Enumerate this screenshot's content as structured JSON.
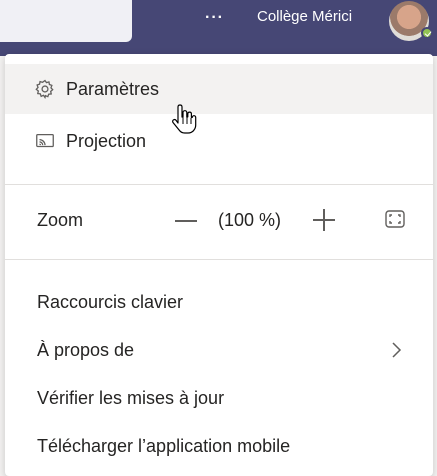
{
  "topbar": {
    "more_label": "···",
    "org_name": "Collège Mérici"
  },
  "menu": {
    "settings_label": "Paramètres",
    "cast_label": "Projection",
    "zoom_label": "Zoom",
    "zoom_value": "(100 %)",
    "keyboard_shortcuts_label": "Raccourcis clavier",
    "about_label": "À propos de",
    "check_updates_label": "Vérifier les mises à jour",
    "download_mobile_label": "Télécharger l’application mobile"
  },
  "icons": {
    "settings": "gear-icon",
    "cast": "cast-icon",
    "zoom_out": "minus-icon",
    "zoom_in": "plus-icon",
    "fullscreen": "fullscreen-icon",
    "about_submenu": "chevron-right-icon"
  },
  "colors": {
    "topbar": "#464775",
    "menu_background": "#ffffff",
    "hover": "#f3f2f1",
    "presence_available": "#92c353"
  }
}
